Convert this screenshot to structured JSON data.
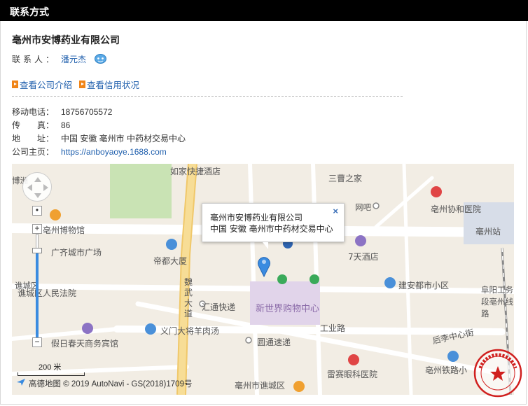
{
  "header": {
    "title": "联系方式"
  },
  "company": {
    "name": "亳州市安博药业有限公司"
  },
  "contact": {
    "label": "联系人：",
    "name": "潘元杰",
    "chat_icon": "chat-bubble-icon"
  },
  "links": [
    {
      "label": "查看公司介绍",
      "icon": "arrow-box-icon"
    },
    {
      "label": "查看信用状况",
      "icon": "arrow-box-icon"
    }
  ],
  "info": {
    "mobile_label": "移动电话：",
    "mobile": "18756705572",
    "fax_label": "传　　真：",
    "fax": "86",
    "address_label": "地　　址：",
    "address": "中国 安徽 亳州市 中药材交易中心",
    "homepage_label": "公司主页：",
    "homepage": "https://anboyaoye.1688.com"
  },
  "map": {
    "pois": {
      "p1": "如家快捷酒店",
      "p2": "三曹之家",
      "p3": "亳州协和医院",
      "p4": "亳州博物馆",
      "p5": "广齐城市广场",
      "p6": "帝都大厦",
      "p7": "7天酒店",
      "p8": "亳州站",
      "p9": "谯城区人民法院",
      "p10": "魏武大道",
      "p11": "汇通快递",
      "p12": "新世界购物中心",
      "p13": "建安都市小区",
      "p14": "阜阳工务段亳州线路",
      "p15": "义门大将羊肉汤",
      "p16": "工业路",
      "p17": "假日春天商务宾馆",
      "p18": "圆通速递",
      "p19": "后李中心街",
      "p20": "雷赛眼科医院",
      "p21": "亳州铁路小",
      "p22": "亳州市谯城区",
      "p23": "网吧",
      "p24": "谯城区",
      "p25": "博洲"
    },
    "popup": {
      "line1": "亳州市安博药业有限公司",
      "line2": "中国 安徽 亳州市中药材交易中心",
      "close": "×"
    },
    "scale_label": "200 米",
    "copyright": "高德地图 © 2019 AutoNavi - GS(2018)1709号",
    "zoom": {
      "plus": "+",
      "minus": "−"
    }
  },
  "stamp": {
    "text": "小马爱美剑网络公司",
    "subtext": "www.710zh.com"
  }
}
